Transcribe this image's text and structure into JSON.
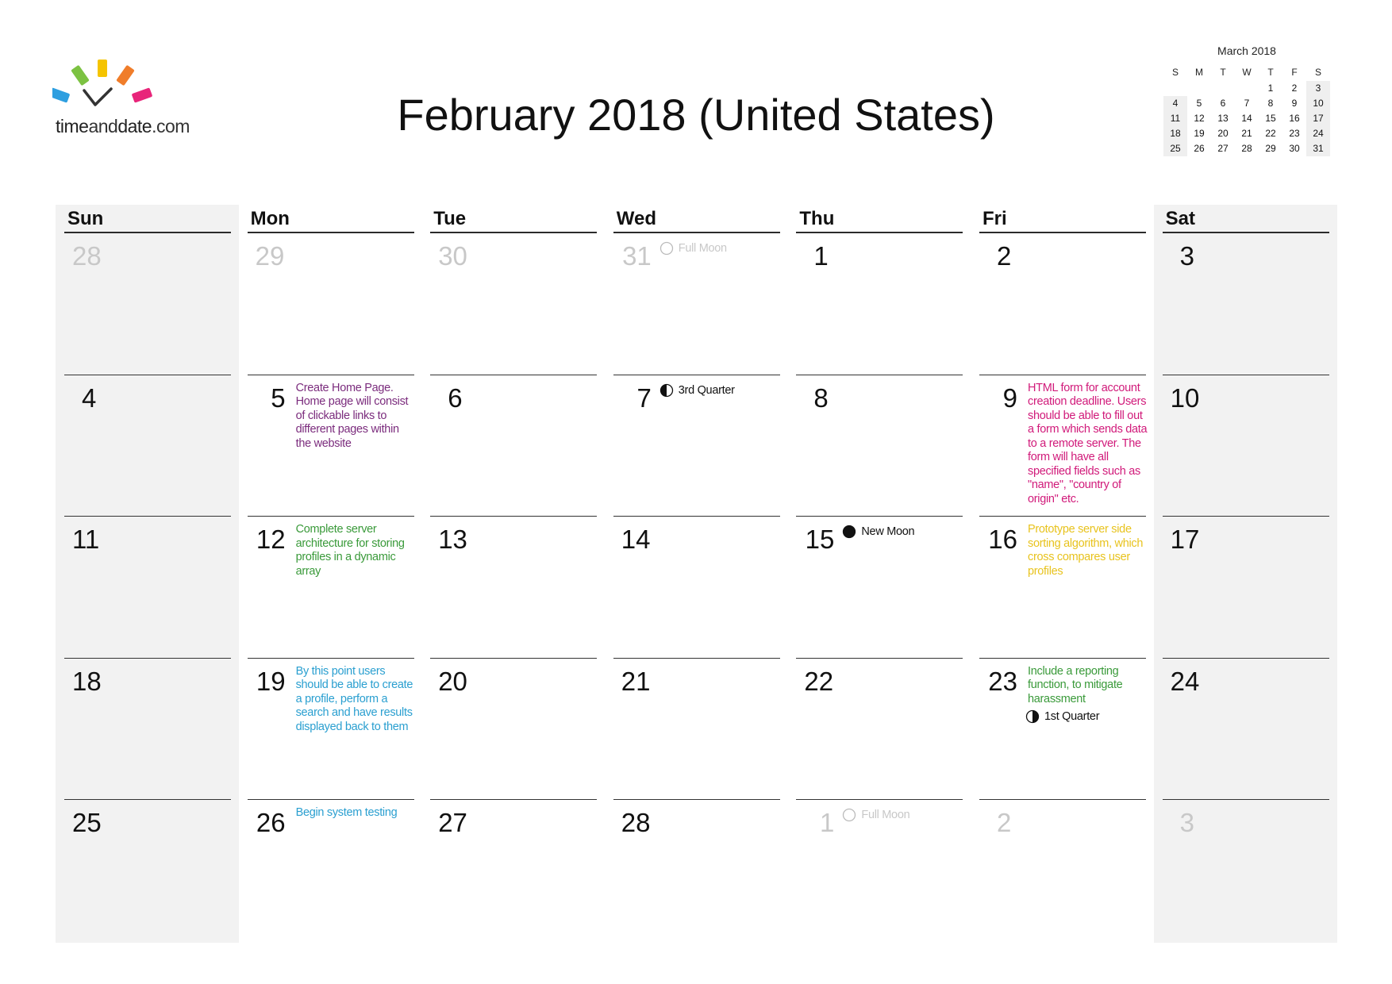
{
  "logo": {
    "text_a": "time",
    "text_b": "and",
    "text_c": "date",
    "text_d": ".com"
  },
  "title": "February 2018 (United States)",
  "mini": {
    "title": "March 2018",
    "headers": [
      "S",
      "M",
      "T",
      "W",
      "T",
      "F",
      "S"
    ],
    "weeks": [
      [
        "",
        "",
        "",
        "",
        "1",
        "2",
        "3"
      ],
      [
        "4",
        "5",
        "6",
        "7",
        "8",
        "9",
        "10"
      ],
      [
        "11",
        "12",
        "13",
        "14",
        "15",
        "16",
        "17"
      ],
      [
        "18",
        "19",
        "20",
        "21",
        "22",
        "23",
        "24"
      ],
      [
        "25",
        "26",
        "27",
        "28",
        "29",
        "30",
        "31"
      ]
    ]
  },
  "days_header": [
    "Sun",
    "Mon",
    "Tue",
    "Wed",
    "Thu",
    "Fri",
    "Sat"
  ],
  "weeks": [
    [
      {
        "n": "28",
        "other": true
      },
      {
        "n": "29",
        "other": true
      },
      {
        "n": "30",
        "other": true
      },
      {
        "n": "31",
        "other": true,
        "moon": "Full Moon",
        "moon_icon": "full-moon-icon"
      },
      {
        "n": "1"
      },
      {
        "n": "2"
      },
      {
        "n": "3"
      }
    ],
    [
      {
        "n": "4"
      },
      {
        "n": "5",
        "event": "Create Home Page. Home page will consist of clickable links to different pages within the website",
        "color": "#7b2c7d"
      },
      {
        "n": "6"
      },
      {
        "n": "7",
        "moon": "3rd Quarter",
        "moon_icon": "third-quarter-moon-icon"
      },
      {
        "n": "8"
      },
      {
        "n": "9",
        "event": "HTML form for account creation deadline. Users should be able to fill out a form which sends data to a remote server. The form will have all specified fields such as \"name\", \"country of origin\" etc.",
        "color": "#d11a7a"
      },
      {
        "n": "10"
      }
    ],
    [
      {
        "n": "11"
      },
      {
        "n": "12",
        "event": "Complete server architecture for storing profiles in a dynamic array",
        "color": "#3a9a3a"
      },
      {
        "n": "13"
      },
      {
        "n": "14"
      },
      {
        "n": "15",
        "moon": "New Moon",
        "moon_icon": "new-moon-icon"
      },
      {
        "n": "16",
        "event": "Prototype server side sorting algorithm, which cross compares user profiles",
        "color": "#e8c31e"
      },
      {
        "n": "17"
      }
    ],
    [
      {
        "n": "18"
      },
      {
        "n": "19",
        "event": "By this point users should be able to create a profile, perform a search and have results displayed back to them",
        "color": "#2a9fd0"
      },
      {
        "n": "20"
      },
      {
        "n": "21"
      },
      {
        "n": "22"
      },
      {
        "n": "23",
        "event": "Include a reporting function, to mitigate harassment",
        "color": "#3a9a3a",
        "moon": "1st Quarter",
        "moon_icon": "first-quarter-moon-icon"
      },
      {
        "n": "24"
      }
    ],
    [
      {
        "n": "25"
      },
      {
        "n": "26",
        "event": "Begin system testing",
        "color": "#2a9fd0"
      },
      {
        "n": "27"
      },
      {
        "n": "28"
      },
      {
        "n": "1",
        "other": true,
        "moon": "Full Moon",
        "moon_icon": "full-moon-icon"
      },
      {
        "n": "2",
        "other": true
      },
      {
        "n": "3",
        "other": true
      }
    ]
  ]
}
